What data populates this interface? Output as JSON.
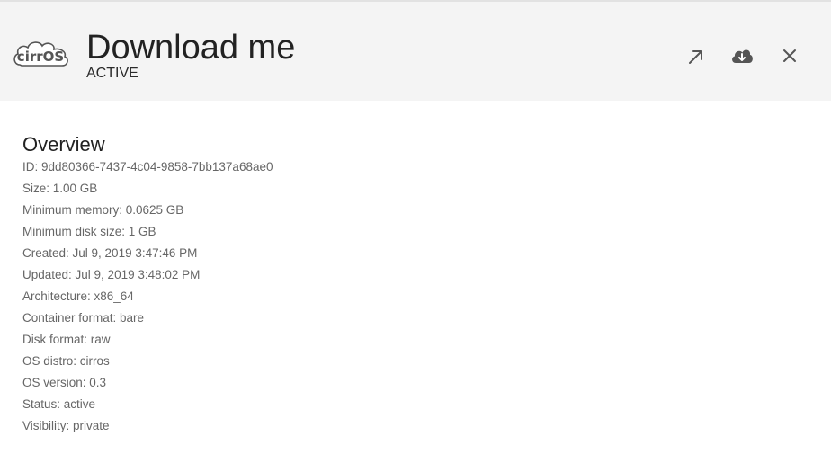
{
  "header": {
    "logo_text": "cirrOS",
    "title": "Download me",
    "status": "ACTIVE",
    "actions": [
      {
        "name": "open-in-new-window",
        "icon": "arrow-up-right-icon"
      },
      {
        "name": "download",
        "icon": "cloud-download-icon"
      },
      {
        "name": "close",
        "icon": "close-icon"
      }
    ]
  },
  "overview": {
    "title": "Overview",
    "properties": [
      "ID: 9dd80366-7437-4c04-9858-7bb137a68ae0",
      "Size: 1.00 GB",
      "Minimum memory: 0.0625 GB",
      "Minimum disk size: 1 GB",
      "Created: Jul 9, 2019 3:47:46 PM",
      "Updated: Jul 9, 2019 3:48:02 PM",
      "Architecture: x86_64",
      "Container format: bare",
      "Disk format: raw",
      "OS distro: cirros",
      "OS version: 0.3",
      "Status: active",
      "Visibility: private"
    ]
  },
  "colors": {
    "header_bg": "#f4f4f4",
    "title_text": "#222222",
    "property_text": "#666666",
    "icon": "#555555"
  }
}
